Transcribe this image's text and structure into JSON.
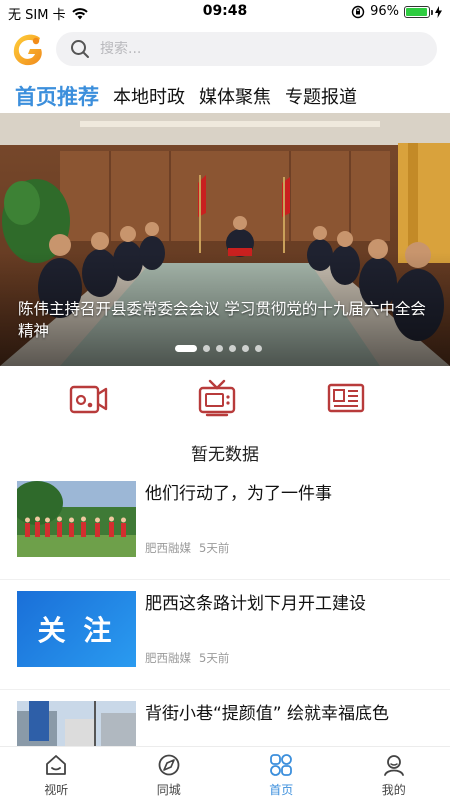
{
  "status_bar": {
    "carrier": "无 SIM 卡",
    "time": "09:48",
    "battery_percent": "96%",
    "battery_level": 0.96,
    "wifi_icon": "wifi-icon",
    "lock_icon": "orientation-lock-icon",
    "charging_icon": "charging-bolt-icon"
  },
  "header": {
    "logo_icon": "app-logo",
    "search_placeholder": "搜索..."
  },
  "tabs": [
    {
      "label": "首页推荐",
      "active": true
    },
    {
      "label": "本地时政",
      "active": false
    },
    {
      "label": "媒体聚焦",
      "active": false
    },
    {
      "label": "专题报道",
      "active": false
    }
  ],
  "banner": {
    "caption": "陈伟主持召开县委常委会会议  学习贯彻党的十九届六中全会精神",
    "slide_count": 6,
    "active_slide": 1
  },
  "quick_icons": [
    "video-camera-icon",
    "tv-icon",
    "newspaper-icon"
  ],
  "no_data_text": "暂无数据",
  "news": [
    {
      "title": "他们行动了，为了一件事",
      "source": "肥西融媒",
      "time": "5天前"
    },
    {
      "title": "肥西这条路计划下月开工建设",
      "source": "肥西融媒",
      "time": "5天前",
      "thumb_text": "关 注"
    },
    {
      "title": "背街小巷“提颜值” 绘就幸福底色",
      "source": "",
      "time": ""
    }
  ],
  "bottom_nav": [
    {
      "label": "视听",
      "icon": "home-icon",
      "active": false
    },
    {
      "label": "同城",
      "icon": "compass-icon",
      "active": false
    },
    {
      "label": "首页",
      "icon": "grid-icon",
      "active": true
    },
    {
      "label": "我的",
      "icon": "user-icon",
      "active": false
    }
  ],
  "colors": {
    "accent": "#3c8fdc",
    "icon_red": "#b83b3b"
  }
}
